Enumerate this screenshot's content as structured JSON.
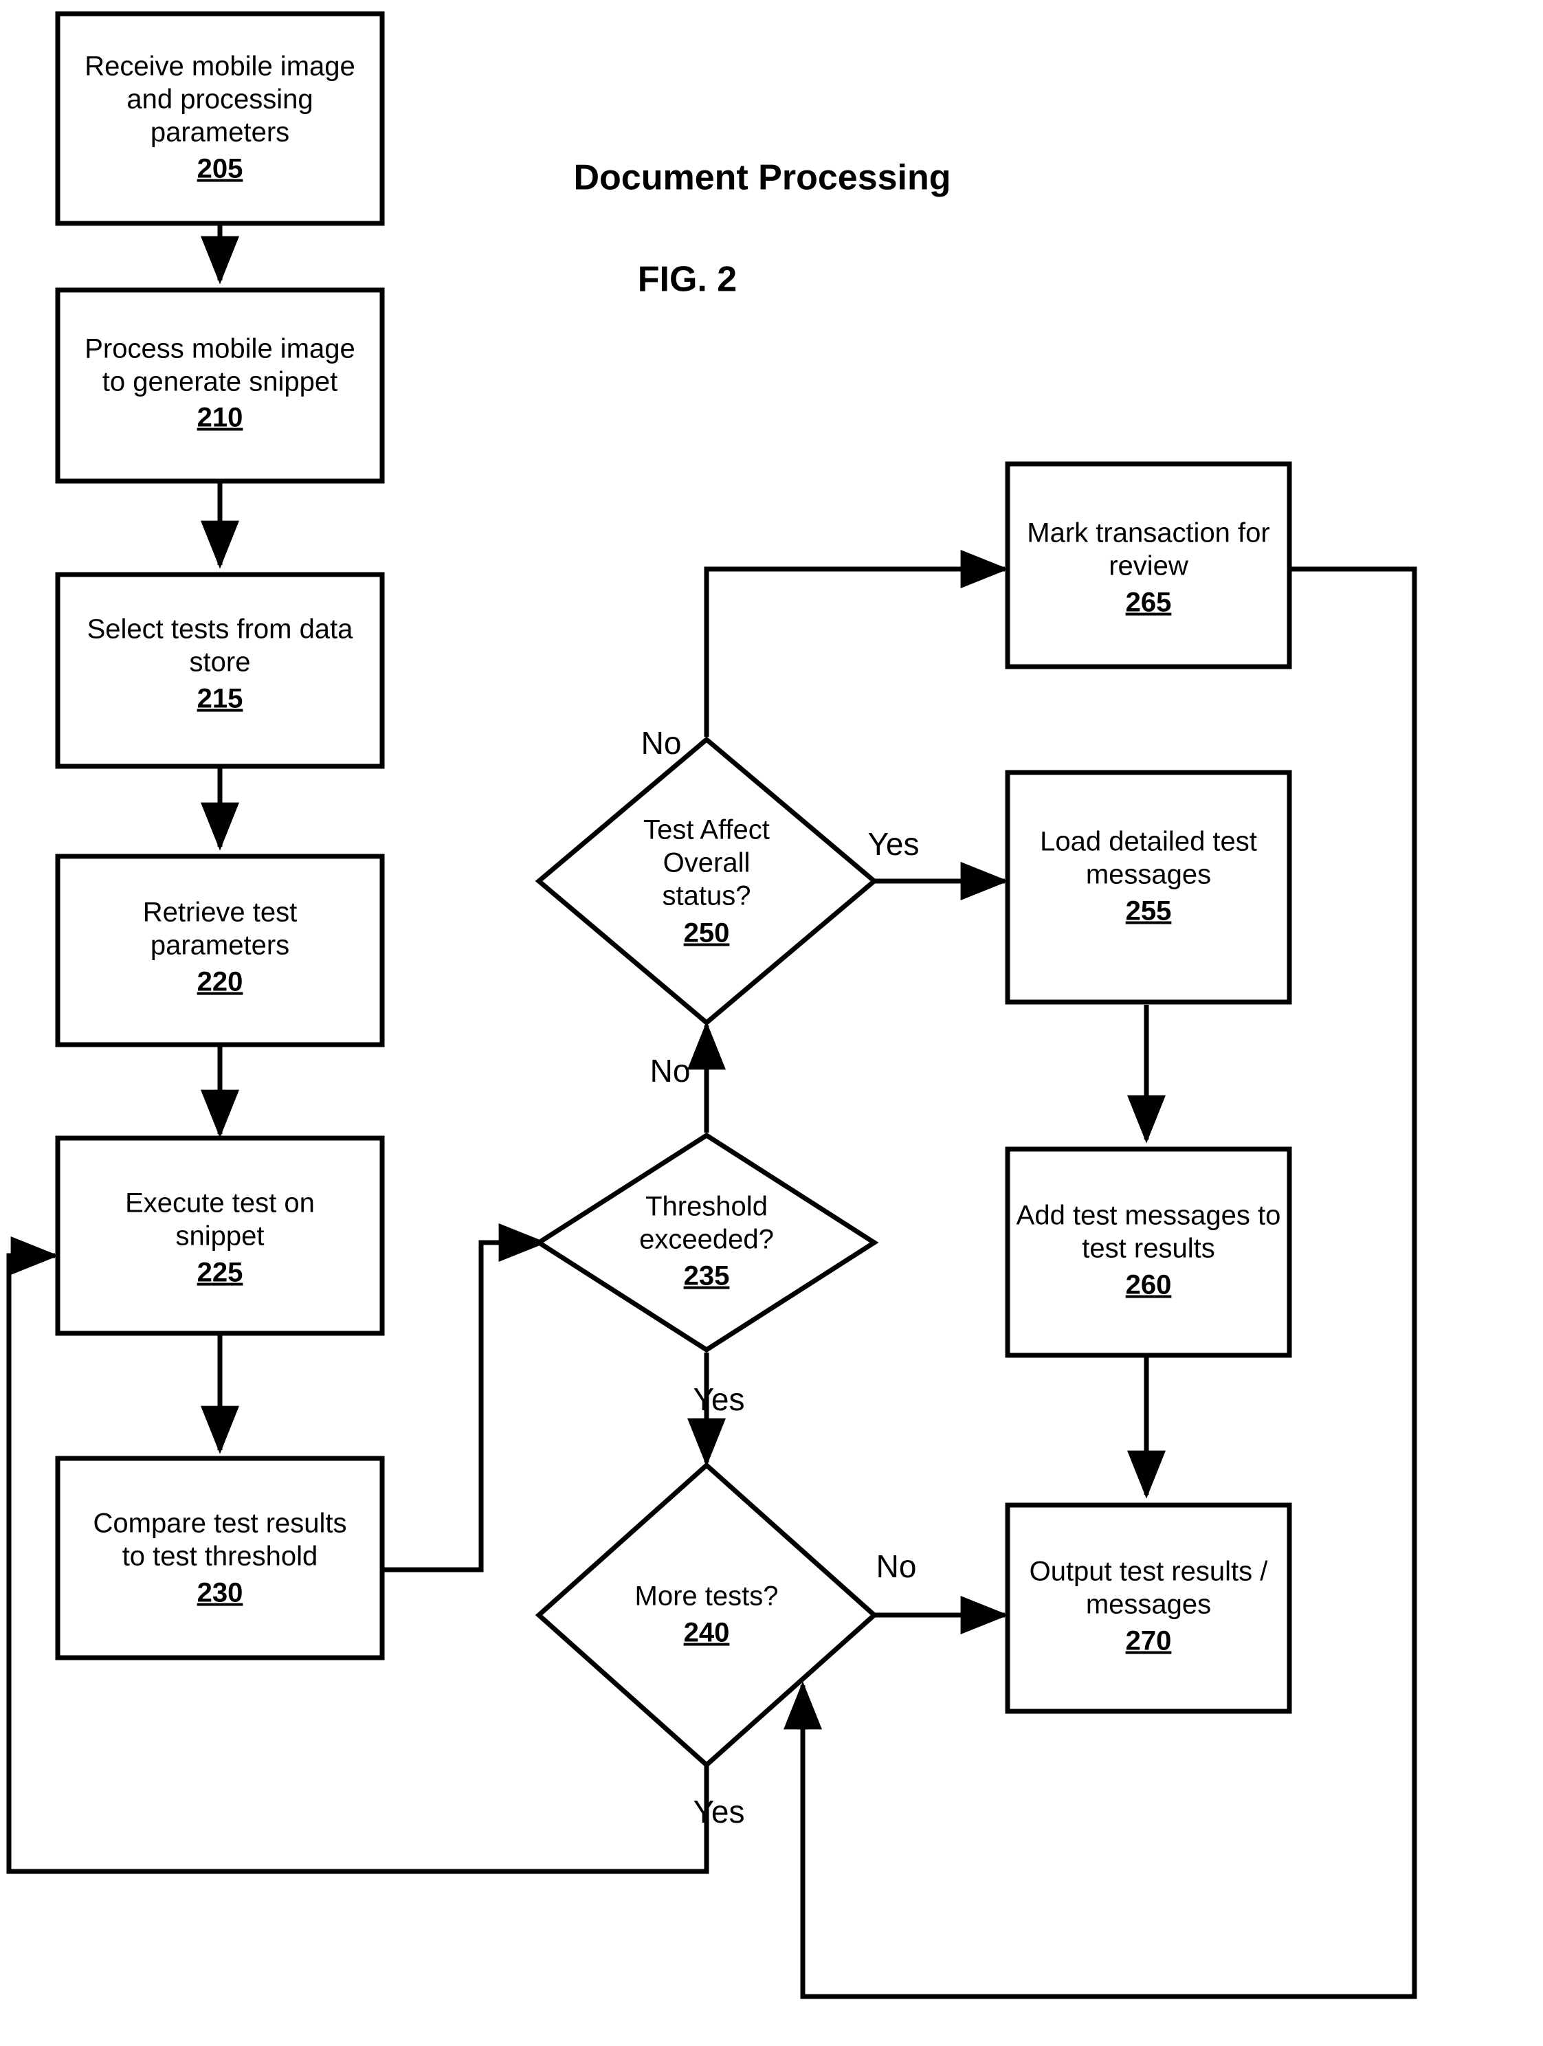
{
  "figure": {
    "title": "Document Processing",
    "caption": "FIG. 2"
  },
  "nodes": {
    "n205": {
      "line1": "Receive mobile image",
      "line2": "and processing",
      "line3": "parameters",
      "ref": "205"
    },
    "n210": {
      "line1": "Process mobile image",
      "line2": "to generate snippet",
      "line3": "",
      "ref": "210"
    },
    "n215": {
      "line1": "Select tests from data",
      "line2": "store",
      "line3": "",
      "ref": "215"
    },
    "n220": {
      "line1": "Retrieve test",
      "line2": "parameters",
      "line3": "",
      "ref": "220"
    },
    "n225": {
      "line1": "Execute test on",
      "line2": "snippet",
      "line3": "",
      "ref": "225"
    },
    "n230": {
      "line1": "Compare test results",
      "line2": "to test threshold",
      "line3": "",
      "ref": "230"
    },
    "n235": {
      "line1": "Threshold",
      "line2": "exceeded?",
      "line3": "",
      "ref": "235"
    },
    "n240": {
      "line1": "More tests?",
      "line2": "",
      "line3": "",
      "ref": "240"
    },
    "n250": {
      "line1": "Test Affect",
      "line2": "Overall",
      "line3": "status?",
      "ref": "250"
    },
    "n255": {
      "line1": "Load detailed test",
      "line2": "messages",
      "line3": "",
      "ref": "255"
    },
    "n260": {
      "line1": "Add test messages to",
      "line2": "test results",
      "line3": "",
      "ref": "260"
    },
    "n265": {
      "line1": "Mark transaction for",
      "line2": "review",
      "line3": "",
      "ref": "265"
    },
    "n270": {
      "line1": "Output test results /",
      "line2": "messages",
      "line3": "",
      "ref": "270"
    }
  },
  "edge_labels": {
    "l250_no": "No",
    "l250_yes": "Yes",
    "l235_no": "No",
    "l235_yes": "Yes",
    "l240_no": "No",
    "l240_yes": "Yes"
  },
  "colors": {
    "stroke": "#000000",
    "fill": "#ffffff"
  }
}
